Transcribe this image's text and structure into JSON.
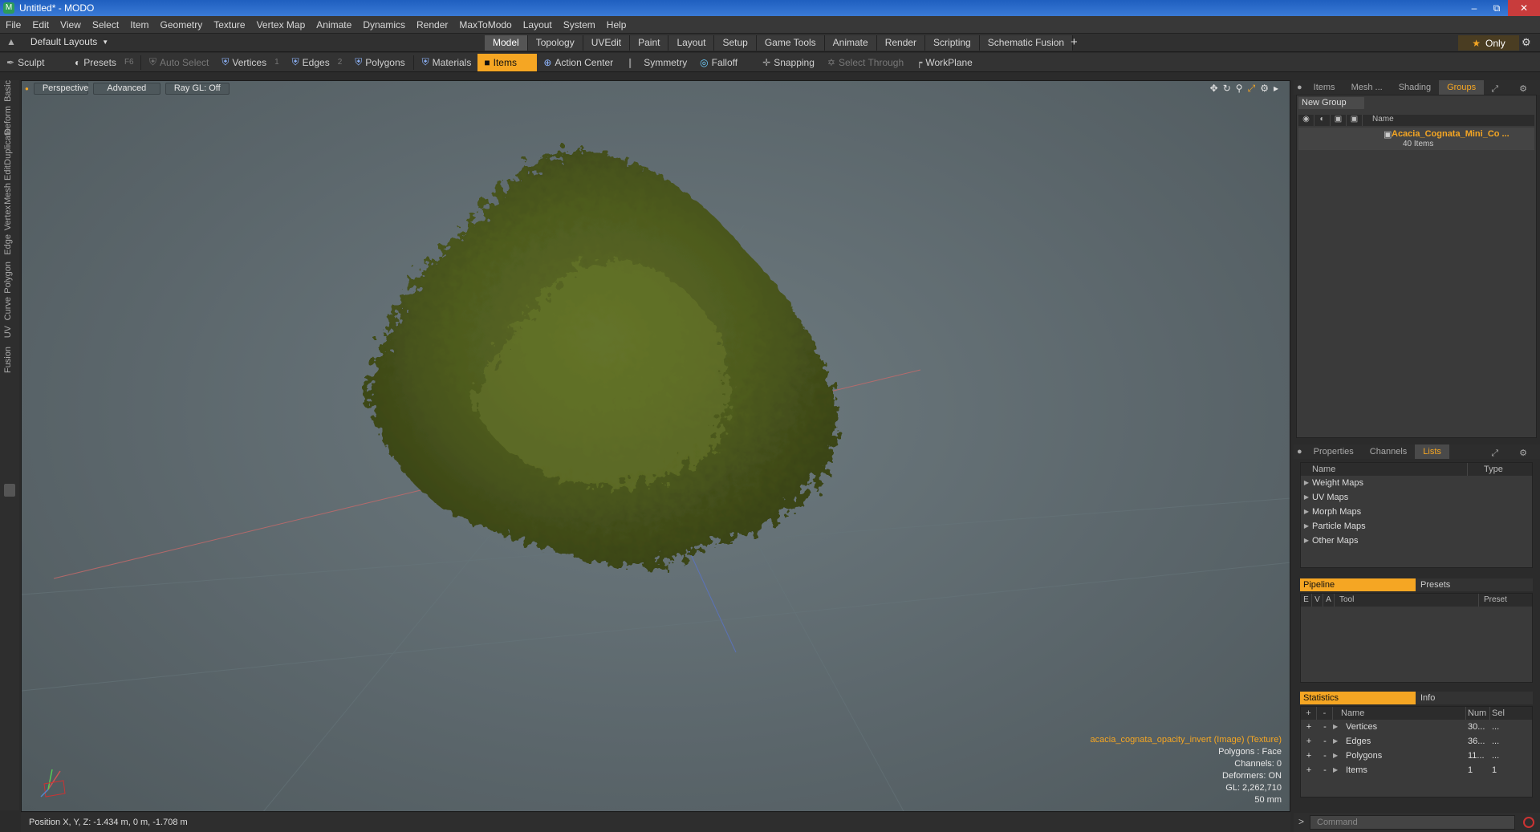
{
  "window": {
    "title": "Untitled* - MODO",
    "app_icon": "modo-icon",
    "controls": [
      "minimize-icon",
      "restore-icon",
      "close-icon"
    ]
  },
  "menu": [
    "File",
    "Edit",
    "View",
    "Select",
    "Item",
    "Geometry",
    "Texture",
    "Vertex Map",
    "Animate",
    "Dynamics",
    "Render",
    "MaxToModo",
    "Layout",
    "System",
    "Help"
  ],
  "layout_selector": {
    "label": "Default Layouts"
  },
  "layout_tabs": [
    {
      "label": "Model",
      "active": true
    },
    {
      "label": "Topology"
    },
    {
      "label": "UVEdit"
    },
    {
      "label": "Paint"
    },
    {
      "label": "Layout"
    },
    {
      "label": "Setup"
    },
    {
      "label": "Game Tools"
    },
    {
      "label": "Animate"
    },
    {
      "label": "Render"
    },
    {
      "label": "Scripting"
    },
    {
      "label": "Schematic Fusion"
    }
  ],
  "only_button": {
    "label": "Only"
  },
  "toolbar": {
    "sculpt": "Sculpt",
    "presets": "Presets",
    "presets_key": "F6",
    "auto_select": "Auto Select",
    "vertices": "Vertices",
    "vertices_key": "1",
    "edges": "Edges",
    "edges_key": "2",
    "polygons": "Polygons",
    "materials": "Materials",
    "items": "Items",
    "action_center": "Action Center",
    "symmetry": "Symmetry",
    "falloff": "Falloff",
    "snapping": "Snapping",
    "select_through": "Select Through",
    "workplane": "WorkPlane"
  },
  "left_tabs": [
    "Basic",
    "Deform",
    "Duplicate",
    "Mesh Edit",
    "Vertex",
    "Edge",
    "Polygon",
    "Curve",
    "UV",
    "Fusion"
  ],
  "viewport": {
    "view": "Perspective",
    "shading": "Advanced",
    "raygl": "Ray GL: Off",
    "info": {
      "texture": "acacia_cognata_opacity_invert (Image) (Texture)",
      "polygons": "Polygons : Face",
      "channels": "Channels: 0",
      "deformers": "Deformers: ON",
      "gl": "GL: 2,262,710",
      "scale": "50 mm"
    }
  },
  "status": {
    "position": "Position X, Y, Z:  -1.434 m, 0 m, -1.708 m"
  },
  "top_panel": {
    "tabs": [
      {
        "label": "Items"
      },
      {
        "label": "Mesh ..."
      },
      {
        "label": "Shading"
      },
      {
        "label": "Groups",
        "active": true
      }
    ],
    "new_group": "New Group",
    "name_header": "Name",
    "group": {
      "name": "Acacia_Cognata_Mini_Co ...",
      "count": "40 Items"
    }
  },
  "mid_panel": {
    "tabs": [
      {
        "label": "Properties"
      },
      {
        "label": "Channels"
      },
      {
        "label": "Lists",
        "active": true
      }
    ],
    "name_header": "Name",
    "type_header": "Type",
    "items": [
      "Weight Maps",
      "UV Maps",
      "Morph Maps",
      "Particle Maps",
      "Other Maps"
    ]
  },
  "pipeline": {
    "tab_on": "Pipeline",
    "tab_off": "Presets",
    "cols": [
      "E",
      "V",
      "A",
      "Tool",
      "Preset"
    ]
  },
  "statistics": {
    "tab_on": "Statistics",
    "tab_off": "Info",
    "cols": [
      "+",
      "-",
      "Name",
      "Num",
      "Sel"
    ],
    "rows": [
      {
        "name": "Vertices",
        "num": "30...",
        "sel": "..."
      },
      {
        "name": "Edges",
        "num": "36...",
        "sel": "..."
      },
      {
        "name": "Polygons",
        "num": "11...",
        "sel": "..."
      },
      {
        "name": "Items",
        "num": "1",
        "sel": "1"
      }
    ]
  },
  "command": {
    "placeholder": "Command"
  },
  "colors": {
    "accent": "#f5a623",
    "viewport_bg": "#5e696e",
    "foliage": "#5a6a25"
  }
}
